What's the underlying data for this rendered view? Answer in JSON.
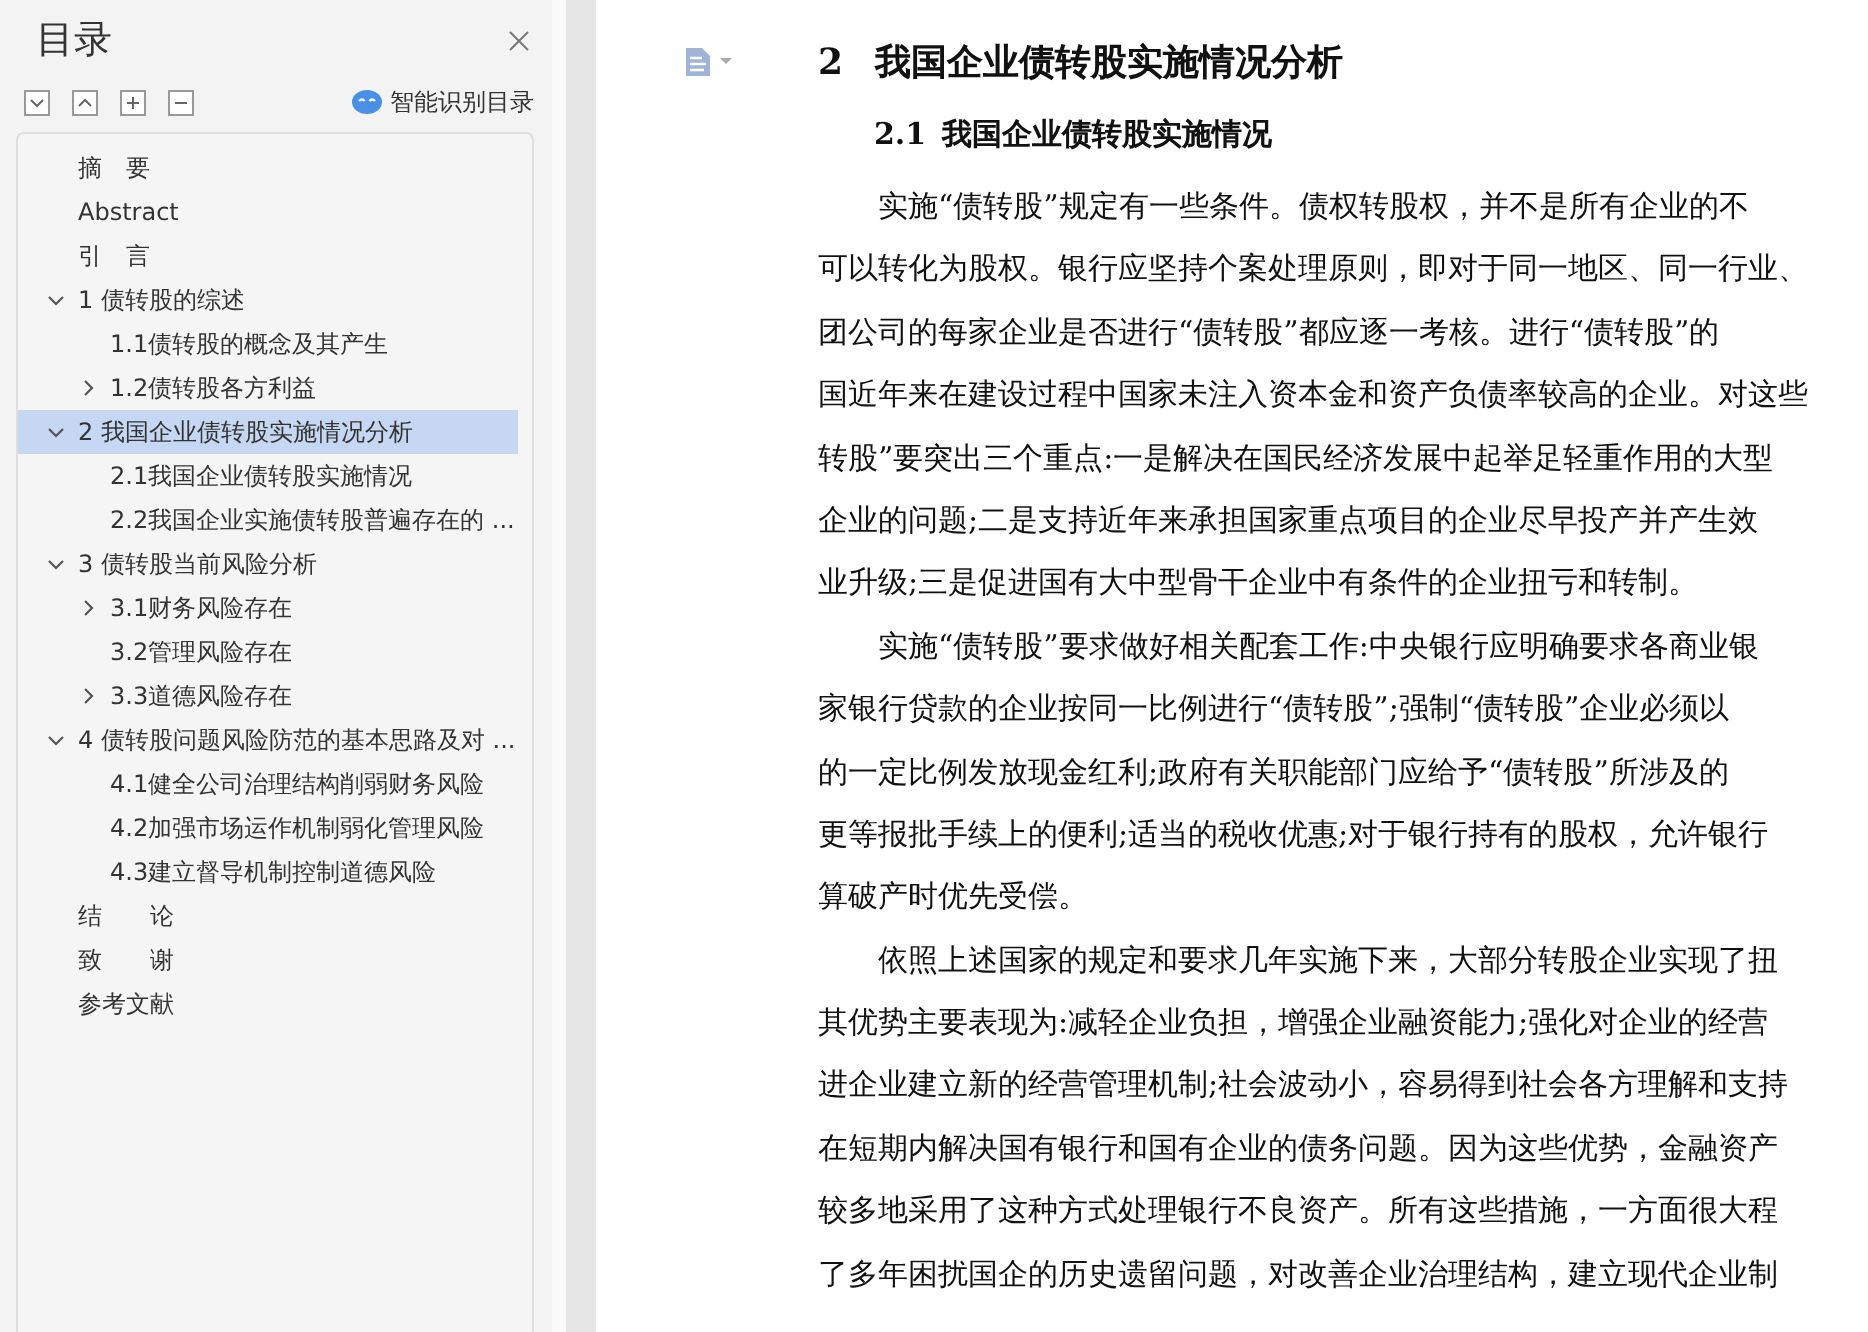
{
  "sidebar": {
    "title": "目录",
    "smart_toc": "智能识别目录",
    "items": [
      {
        "label": "摘　要",
        "selected": false
      },
      {
        "label": "Abstract",
        "selected": false
      },
      {
        "label": "引　言",
        "selected": false
      },
      {
        "label": "1 债转股的综述",
        "selected": false,
        "expanded": true,
        "children": [
          {
            "label": "1.1债转股的概念及其产生",
            "selected": false
          },
          {
            "label": "1.2债转股各方利益",
            "selected": false,
            "expanded": false
          }
        ]
      },
      {
        "label": "2  我国企业债转股实施情况分析",
        "selected": true,
        "expanded": true,
        "children": [
          {
            "label": "2.1我国企业债转股实施情况",
            "selected": false
          },
          {
            "label": "2.2我国企业实施债转股普遍存在的 ...",
            "selected": false
          }
        ]
      },
      {
        "label": "3  债转股当前风险分析",
        "selected": false,
        "expanded": true,
        "children": [
          {
            "label": "3.1财务风险存在",
            "selected": false,
            "expanded": false
          },
          {
            "label": "3.2管理风险存在",
            "selected": false
          },
          {
            "label": "3.3道德风险存在",
            "selected": false,
            "expanded": false
          }
        ]
      },
      {
        "label": "4  债转股问题风险防范的基本思路及对 ...",
        "selected": false,
        "expanded": true,
        "children": [
          {
            "label": "4.1健全公司治理结构削弱财务风险",
            "selected": false
          },
          {
            "label": "4.2加强市场运作机制弱化管理风险",
            "selected": false
          },
          {
            "label": "4.3建立督导机制控制道德风险",
            "selected": false
          }
        ]
      },
      {
        "label": "结　　论",
        "selected": false
      },
      {
        "label": "致　　谢",
        "selected": false
      },
      {
        "label": "参考文献",
        "selected": false
      }
    ]
  },
  "document": {
    "heading": {
      "number": "2",
      "text": "我国企业债转股实施情况分析"
    },
    "subheading": {
      "number": "2.1",
      "text": "我国企业债转股实施情况"
    },
    "paragraphs": [
      [
        "实施“债转股”规定有一些条件。债权转股权，并不是所有企业的不",
        "可以转化为股权。银行应坚持个案处理原则，即对于同一地区、同一行业、",
        "团公司的每家企业是否进行“债转股”都应逐一考核。进行“债转股”的",
        "国近年来在建设过程中国家未注入资本金和资产负债率较高的企业。对这些",
        "转股”要突出三个重点:一是解决在国民经济发展中起举足轻重作用的大型",
        "企业的问题;二是支持近年来承担国家重点项目的企业尽早投产并产生效",
        "业升级;三是促进国有大中型骨干企业中有条件的企业扭亏和转制。"
      ],
      [
        "实施“债转股”要求做好相关配套工作:中央银行应明确要求各商业银",
        "家银行贷款的企业按同一比例进行“债转股”;强制“债转股”企业必须以",
        "的一定比例发放现金红利;政府有关职能部门应给予“债转股”所涉及的",
        "更等报批手续上的便利;适当的税收优惠;对于银行持有的股权，允许银行",
        "算破产时优先受偿。"
      ],
      [
        "依照上述国家的规定和要求几年实施下来，大部分转股企业实现了扭",
        "其优势主要表现为:减轻企业负担，增强企业融资能力;强化对企业的经营",
        "进企业建立新的经营管理机制;社会波动小，容易得到社会各方理解和支持",
        "在短期内解决国有银行和国有企业的债务问题。因为这些优势，金融资产",
        "较多地采用了这种方式处理银行不良资产。所有这些措施，一方面很大程",
        "了多年困扰国企的历史遗留问题，对改善企业治理结构，建立现代企业制"
      ]
    ]
  }
}
